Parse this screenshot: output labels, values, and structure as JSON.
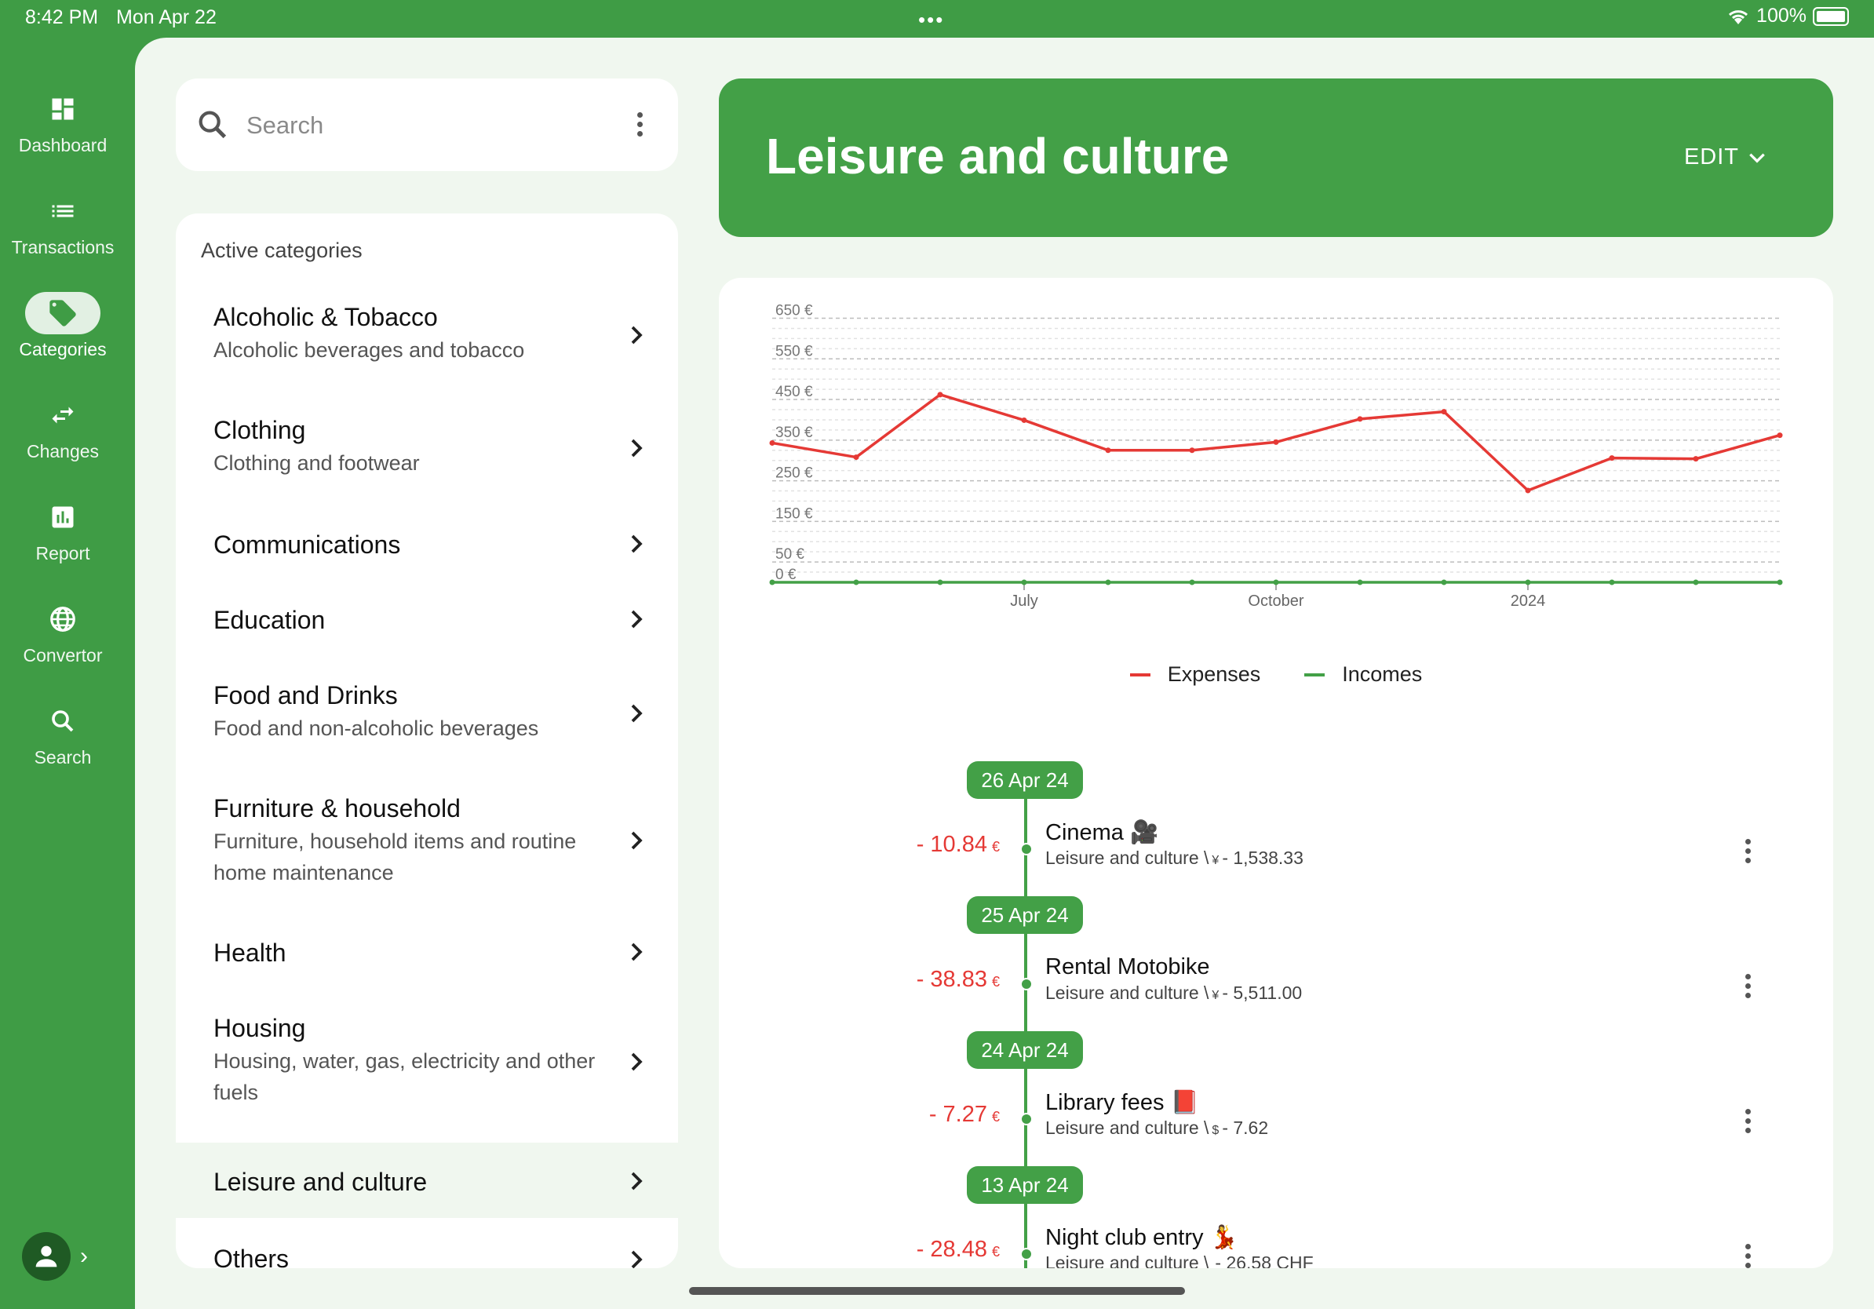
{
  "status_bar": {
    "time": "8:42 PM",
    "date": "Mon Apr 22",
    "dots": "•••",
    "battery": "100%"
  },
  "nav": [
    {
      "label": "Dashboard",
      "icon": "dashboard-icon"
    },
    {
      "label": "Transactions",
      "icon": "list-icon"
    },
    {
      "label": "Categories",
      "icon": "tag-icon",
      "active": true
    },
    {
      "label": "Changes",
      "icon": "swap-arrows-icon"
    },
    {
      "label": "Report",
      "icon": "bar-chart-icon"
    },
    {
      "label": "Convertor",
      "icon": "globe-icon"
    },
    {
      "label": "Search",
      "icon": "search-icon"
    }
  ],
  "search": {
    "placeholder": "Search"
  },
  "categories": {
    "header": "Active categories",
    "items": [
      {
        "title": "Alcoholic & Tobacco",
        "subtitle": "Alcoholic beverages and tobacco"
      },
      {
        "title": "Clothing",
        "subtitle": "Clothing and footwear"
      },
      {
        "title": "Communications",
        "subtitle": ""
      },
      {
        "title": "Education",
        "subtitle": ""
      },
      {
        "title": "Food and Drinks",
        "subtitle": "Food and non-alcoholic beverages"
      },
      {
        "title": "Furniture & household",
        "subtitle": "Furniture, household items and routine home maintenance"
      },
      {
        "title": "Health",
        "subtitle": ""
      },
      {
        "title": "Housing",
        "subtitle": "Housing, water, gas, electricity and other fuels"
      },
      {
        "title": "Leisure and culture",
        "subtitle": "",
        "selected": true
      },
      {
        "title": "Others",
        "subtitle": ""
      }
    ]
  },
  "header": {
    "title": "Leisure and culture",
    "edit_label": "EDIT"
  },
  "chart_data": {
    "type": "line",
    "y_ticks": [
      "650 €",
      "550 €",
      "450 €",
      "350 €",
      "250 €",
      "150 €",
      "50 €",
      "0 €"
    ],
    "y_tick_values": [
      650,
      550,
      450,
      350,
      250,
      150,
      50,
      0
    ],
    "ylim": [
      0,
      680
    ],
    "x_tick_labels": [
      {
        "label": "July",
        "index": 3
      },
      {
        "label": "October",
        "index": 6
      },
      {
        "label": "2024",
        "index": 9
      }
    ],
    "series": [
      {
        "name": "Expenses",
        "color": "#e53935",
        "values": [
          343,
          308,
          462,
          399,
          325,
          325,
          345,
          402,
          420,
          226,
          306,
          304,
          362
        ]
      },
      {
        "name": "Incomes",
        "color": "#43a047",
        "values": [
          0,
          0,
          0,
          0,
          0,
          0,
          0,
          0,
          0,
          0,
          0,
          0,
          0
        ]
      }
    ],
    "grid": true,
    "legend": "bottom-center"
  },
  "legend": {
    "expenses": "Expenses",
    "incomes": "Incomes"
  },
  "transactions": [
    {
      "date": "26 Apr 24",
      "amount": "- 10.84",
      "amount_cur": "€",
      "title": "Cinema 🎥",
      "sub_path": "Leisure and culture \\",
      "sub_cur": "¥",
      "sub_amount": "- 1,538.33"
    },
    {
      "date": "25 Apr 24",
      "amount": "- 38.83",
      "amount_cur": "€",
      "title": "Rental Motobike",
      "sub_path": "Leisure and culture \\",
      "sub_cur": "¥",
      "sub_amount": "- 5,511.00"
    },
    {
      "date": "24 Apr 24",
      "amount": "- 7.27",
      "amount_cur": "€",
      "title": "Library fees 📕",
      "sub_path": "Leisure and culture \\",
      "sub_cur": "$",
      "sub_amount": "- 7.62"
    },
    {
      "date": "13 Apr 24",
      "amount": "- 28.48",
      "amount_cur": "€",
      "title": "Night club entry 💃",
      "sub_path": "Leisure and culture \\",
      "sub_cur": "",
      "sub_amount": "- 26.58 CHF"
    }
  ],
  "colors": {
    "brand_green": "#43a047",
    "nav_green": "#3f9c45",
    "expense_red": "#e53935",
    "surface": "#f0f7ef"
  }
}
